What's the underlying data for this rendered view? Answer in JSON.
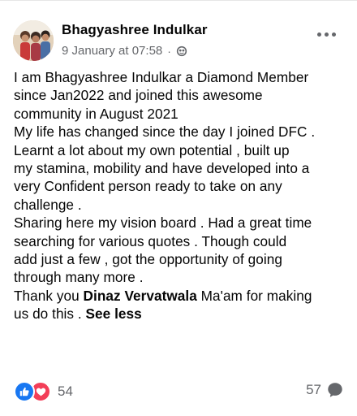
{
  "post": {
    "author": "Bhagyashree Indulkar",
    "timestamp": "9 January at 07:58",
    "separator": "·",
    "privacy_icon": "globe-icon",
    "more_icon": "ellipsis-icon",
    "body_lines": [
      "I am Bhagyashree Indulkar a Diamond Member",
      "since Jan2022 and joined this awesome",
      "community in August 2021",
      "My life has changed since the day I joined DFC .",
      "Learnt a lot about my own potential , built up",
      "my stamina, mobility and have developed into a",
      "very Confident person ready to take on any",
      "challenge .",
      "Sharing here my vision board . Had a great time",
      "searching for various quotes . Though could",
      "add just a few , got the opportunity of going",
      "through many more .",
      "Thank you ",
      "Ma'am for making",
      "us do this . ",
      "See less"
    ],
    "mention": "Dinaz Vervatwala",
    "see_less": "See less"
  },
  "footer": {
    "reaction_icons": [
      "like-icon",
      "love-icon"
    ],
    "reaction_count": "54",
    "comment_count": "57",
    "comment_icon": "comment-bubble-icon"
  },
  "colors": {
    "text": "#050505",
    "secondary": "#65676b",
    "like": "#1877f2",
    "love": "#f33e58"
  }
}
